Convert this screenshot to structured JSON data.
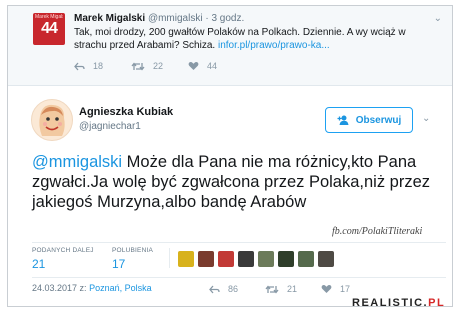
{
  "top_tweet": {
    "avatar_text": "44",
    "avatar_small": "Marek Migalski",
    "name": "Marek Migalski",
    "handle": "@mmigalski",
    "separator": "·",
    "time": "3 godz.",
    "text": "Tak, moi drodzy, 200 gwałtów Polaków na Polkach. Dziennie. A wy wciąż w strachu przed Arabami? Schiza.",
    "link": "infor.pl/prawo/prawo-ka...",
    "reply_count": "18",
    "retweet_count": "22",
    "like_count": "44"
  },
  "main_tweet": {
    "name": "Agnieszka Kubiak",
    "handle": "@jagniechar1",
    "follow_label": "Obserwuj",
    "mention": "@mmigalski",
    "text": " Może dla Pana nie ma różnicy,kto Pana zgwałci.Ja wolę być zgwałcona przez Polaka,niż przez jakiegoś Murzyna,albo bandę Arabów",
    "watermark": "fb.com/PolakiTliteraki",
    "retweets_label": "PODANYCH DALEJ",
    "retweets_value": "21",
    "likes_label": "POLUBIENIA",
    "likes_value": "17",
    "date": "24.03.2017 z:",
    "location": "Poznań, Polska",
    "reply_count": "86",
    "retweet_count": "21",
    "like_count": "17",
    "liker_colors": [
      "#d8b21c",
      "#7a3b2e",
      "#c23a36",
      "#3a3a3a",
      "#6c7b5a",
      "#2f3e2a",
      "#556a4c",
      "#4e4a44"
    ]
  },
  "branding": {
    "main": "REALISTIC.",
    "suffix": "PL"
  },
  "colors": {
    "link": "#1b95e0",
    "muted": "#657786",
    "accent_red": "#c8272d"
  }
}
